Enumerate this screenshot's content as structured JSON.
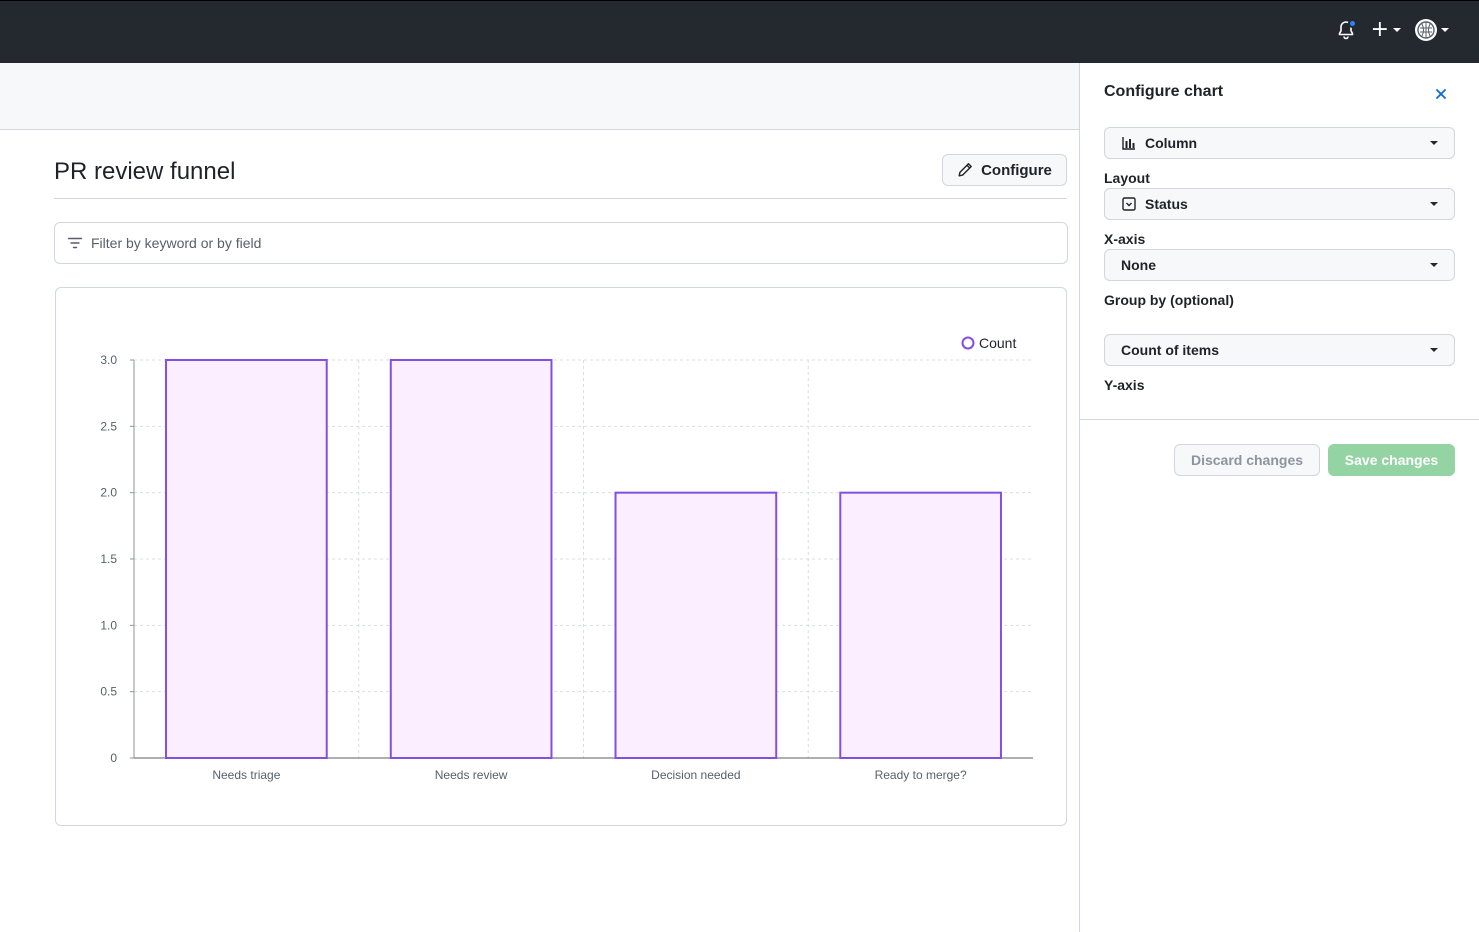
{
  "topbar": {
    "icons": [
      "bell-icon",
      "plus-icon",
      "avatar"
    ],
    "notification_color": "#2f81f7",
    "bg_color": "#24292f"
  },
  "page": {
    "title": "PR review funnel",
    "configure_label": "Configure",
    "filter_placeholder": "Filter by keyword or by field"
  },
  "chart_data": {
    "type": "bar",
    "categories": [
      "Needs triage",
      "Needs review",
      "Decision needed",
      "Ready to merge?"
    ],
    "series": [
      {
        "name": "Count",
        "values": [
          3,
          3,
          2,
          2
        ]
      }
    ],
    "ylim": [
      0,
      3.0
    ],
    "yticks": [
      "0",
      "0.5",
      "1.0",
      "1.5",
      "2.0",
      "2.5",
      "3.0"
    ],
    "legend_position": "top-right",
    "grid": true,
    "bar_stroke": "#8250df",
    "bar_fill": "#fbefff"
  },
  "panel": {
    "title": "Configure chart",
    "chart_type_value": "Column",
    "layout_label": "Layout",
    "layout_value": "Status",
    "xaxis_label": "X-axis",
    "xaxis_value": "None",
    "groupby_label": "Group by (optional)",
    "yaxis_value": "Count of items",
    "yaxis_label": "Y-axis",
    "discard_label": "Discard changes",
    "save_label": "Save changes"
  }
}
